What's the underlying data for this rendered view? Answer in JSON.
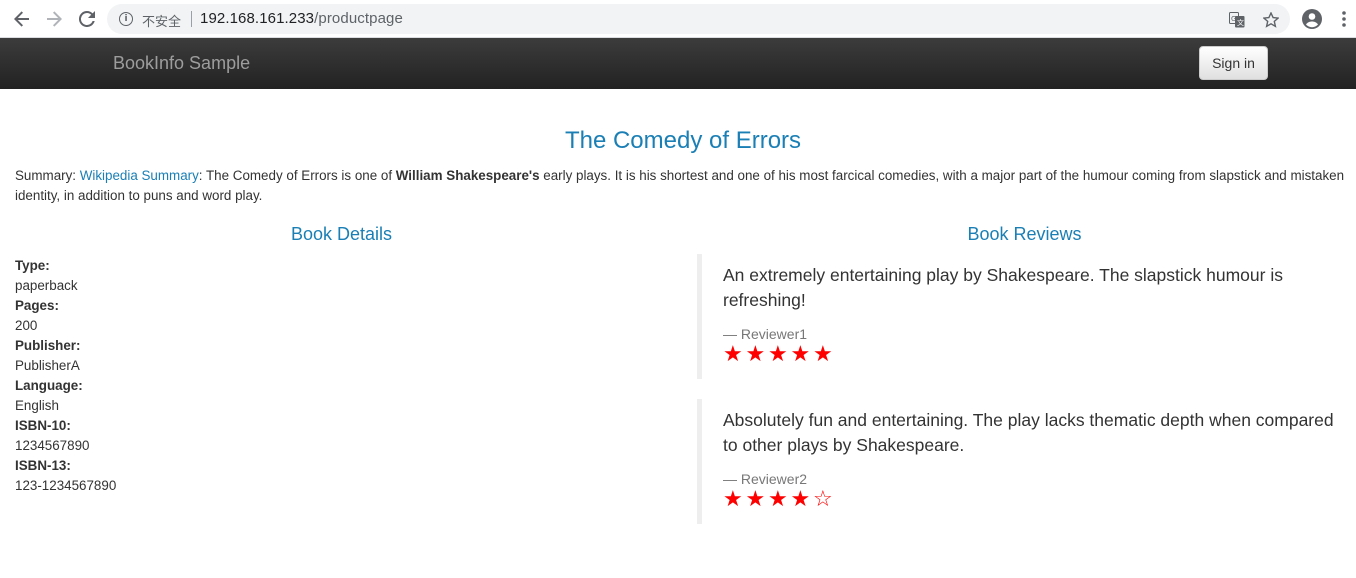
{
  "browser": {
    "insecure_label": "不安全",
    "url_host": "192.168.161.233",
    "url_path": "/productpage"
  },
  "navbar": {
    "brand": "BookInfo Sample",
    "signin_label": "Sign in"
  },
  "product": {
    "title": "The Comedy of Errors",
    "summary_prefix": "Summary: ",
    "summary_link": "Wikipedia Summary",
    "summary_text_1": ": The Comedy of Errors is one of ",
    "summary_bold": "William Shakespeare's",
    "summary_text_2": " early plays. It is his shortest and one of his most farcical comedies, with a major part of the humour coming from slapstick and mistaken identity, in addition to puns and word play."
  },
  "details": {
    "heading": "Book Details",
    "type_label": "Type:",
    "type_value": "paperback",
    "pages_label": "Pages:",
    "pages_value": "200",
    "publisher_label": "Publisher:",
    "publisher_value": "PublisherA",
    "language_label": "Language:",
    "language_value": "English",
    "isbn10_label": "ISBN-10:",
    "isbn10_value": "1234567890",
    "isbn13_label": "ISBN-13:",
    "isbn13_value": "123-1234567890"
  },
  "reviews": {
    "heading": "Book Reviews",
    "items": [
      {
        "text": "An extremely entertaining play by Shakespeare. The slapstick humour is refreshing!",
        "reviewer": "— Reviewer1",
        "rating": 5,
        "max": 5
      },
      {
        "text": "Absolutely fun and entertaining. The play lacks thematic depth when compared to other plays by Shakespeare.",
        "reviewer": "— Reviewer2",
        "rating": 4,
        "max": 5
      }
    ]
  },
  "colors": {
    "link": "#1a7fb5",
    "star": "#ff0000",
    "navbar": "#222222"
  }
}
